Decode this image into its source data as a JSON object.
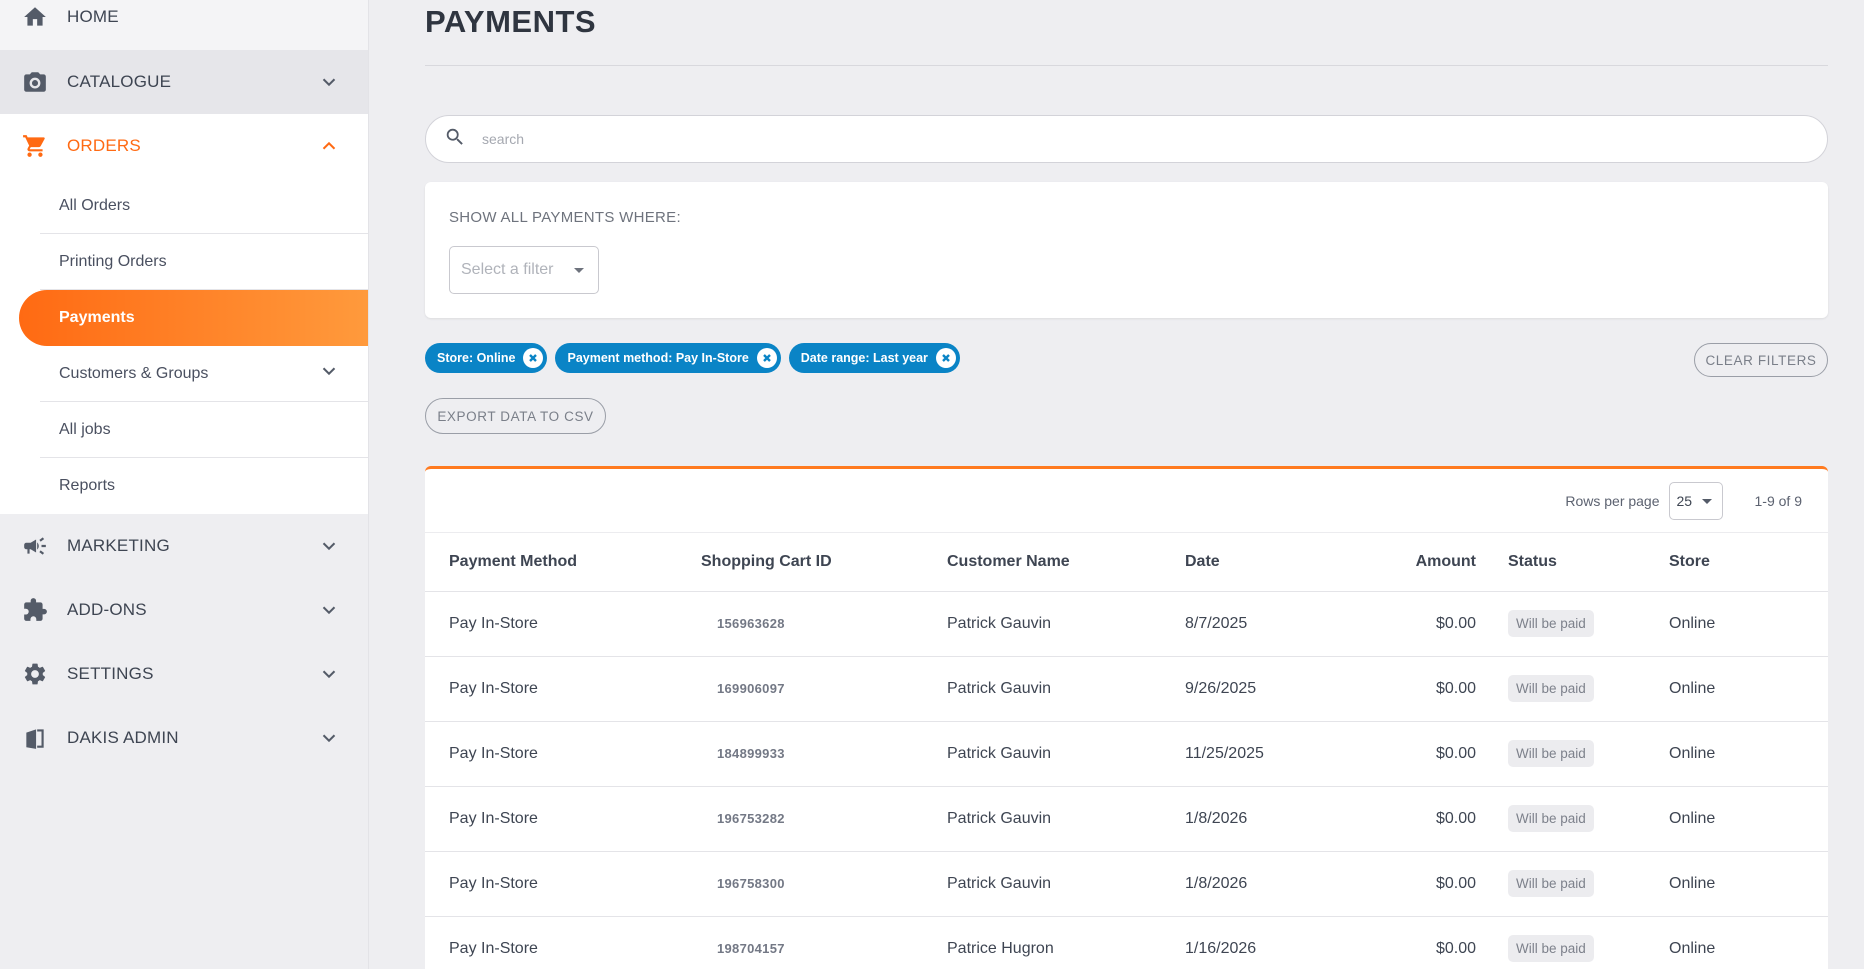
{
  "sidebar": {
    "home": "HOME",
    "catalogue": "CATALOGUE",
    "orders": "ORDERS",
    "orders_sub": {
      "all_orders": "All Orders",
      "printing_orders": "Printing Orders",
      "payments": "Payments",
      "customers_groups": "Customers & Groups",
      "all_jobs": "All jobs",
      "reports": "Reports"
    },
    "marketing": "MARKETING",
    "addons": "ADD-ONS",
    "settings": "SETTINGS",
    "dakis_admin": "DAKIS ADMIN"
  },
  "page": {
    "title": "PAYMENTS"
  },
  "search": {
    "placeholder": "search"
  },
  "filters": {
    "heading": "SHOW ALL PAYMENTS WHERE:",
    "select_placeholder": "Select a filter",
    "chips": [
      "Store: Online",
      "Payment method: Pay In-Store",
      "Date range: Last year"
    ],
    "clear_label": "CLEAR FILTERS",
    "export_label": "EXPORT DATA TO CSV"
  },
  "table": {
    "rows_per_page_label": "Rows per page",
    "rows_per_page_value": "25",
    "page_range": "1-9 of 9",
    "columns": [
      "Payment Method",
      "Shopping Cart ID",
      "Customer Name",
      "Date",
      "Amount",
      "Status",
      "Store"
    ],
    "rows": [
      {
        "method": "Pay In-Store",
        "cart": "156963628",
        "name": "Patrick Gauvin",
        "date": "8/7/2025",
        "amount": "$0.00",
        "status": "Will be paid",
        "store": "Online"
      },
      {
        "method": "Pay In-Store",
        "cart": "169906097",
        "name": "Patrick Gauvin",
        "date": "9/26/2025",
        "amount": "$0.00",
        "status": "Will be paid",
        "store": "Online"
      },
      {
        "method": "Pay In-Store",
        "cart": "184899933",
        "name": "Patrick Gauvin",
        "date": "11/25/2025",
        "amount": "$0.00",
        "status": "Will be paid",
        "store": "Online"
      },
      {
        "method": "Pay In-Store",
        "cart": "196753282",
        "name": "Patrick Gauvin",
        "date": "1/8/2026",
        "amount": "$0.00",
        "status": "Will be paid",
        "store": "Online"
      },
      {
        "method": "Pay In-Store",
        "cart": "196758300",
        "name": "Patrick Gauvin",
        "date": "1/8/2026",
        "amount": "$0.00",
        "status": "Will be paid",
        "store": "Online"
      },
      {
        "method": "Pay In-Store",
        "cart": "198704157",
        "name": "Patrice Hugron",
        "date": "1/16/2026",
        "amount": "$0.00",
        "status": "Will be paid",
        "store": "Online"
      }
    ]
  },
  "colors": {
    "accent": "#ff6a13",
    "chip": "#0a84c6"
  }
}
